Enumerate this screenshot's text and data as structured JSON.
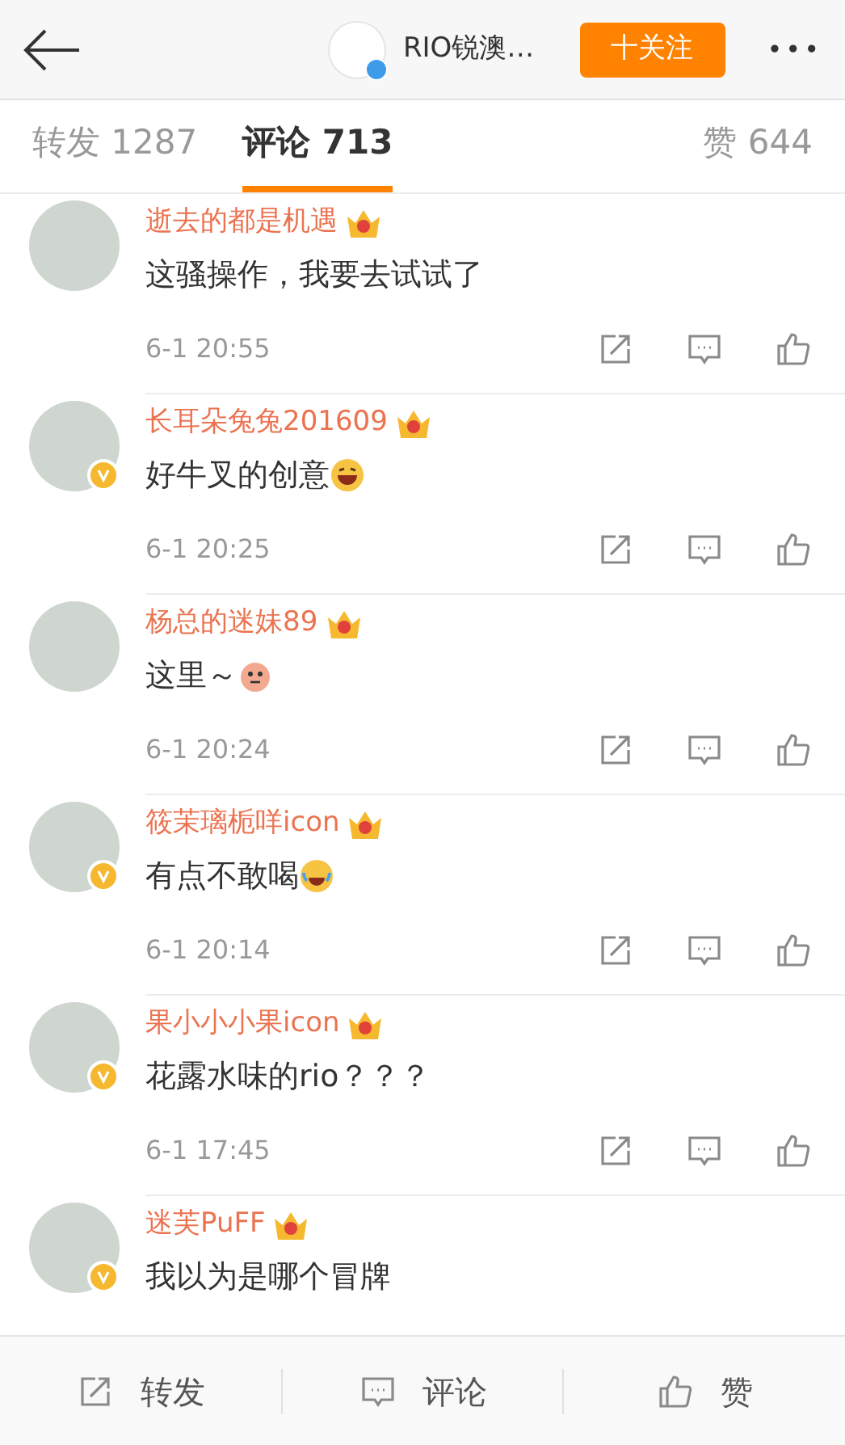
{
  "header": {
    "account_name": "RIO锐澳…",
    "account_verified": true,
    "follow_button": "十关注",
    "more_icon": "•••"
  },
  "tabs": [
    {
      "label": "转发 1287",
      "selected": false
    },
    {
      "label": "评论 713",
      "selected": true
    },
    {
      "label": "赞 644",
      "selected": false
    }
  ],
  "comments": [
    {
      "name": "逝去的都是机遇",
      "verified": false,
      "text": "这骚操作，我要去试试了",
      "time": "6-1 20:55"
    },
    {
      "name": "长耳朵兔兔201609",
      "verified": true,
      "text": "好牛叉的创意",
      "emoji": {
        "kind": "laugh"
      },
      "time": "6-1 20:25"
    },
    {
      "name": "杨总的迷妹89",
      "verified": false,
      "text": "这里～",
      "emoji": {
        "kind": "creature"
      },
      "time": "6-1 20:24"
    },
    {
      "name": "筱茉璃栀咩icon",
      "verified": true,
      "text": "有点不敢喝",
      "emoji": {
        "kind": "cry-laugh"
      },
      "time": "6-1 20:14"
    },
    {
      "name": "果小小小果icon",
      "verified": true,
      "text": "花露水味的rio？？？",
      "time": "6-1 17:45"
    },
    {
      "name": "迷芙PuFF",
      "verified": true,
      "text": "我以为是哪个冒牌"
    }
  ],
  "bottom_bar": [
    {
      "kind": "repost",
      "label": "转发"
    },
    {
      "kind": "comment",
      "label": "评论"
    },
    {
      "kind": "like",
      "label": "赞"
    }
  ]
}
